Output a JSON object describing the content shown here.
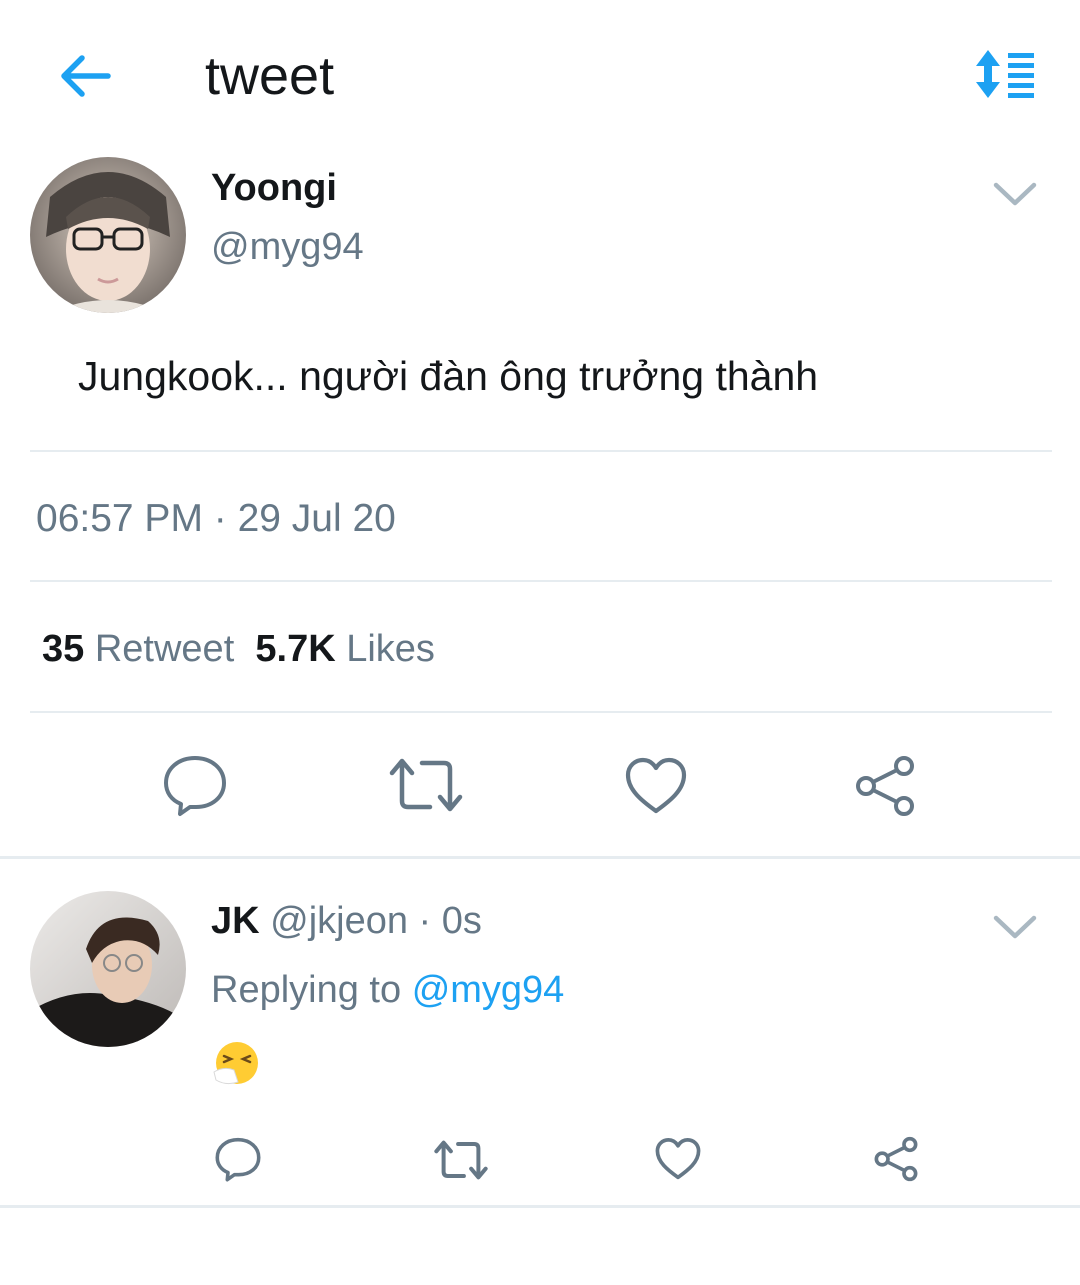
{
  "header": {
    "title": "tweet"
  },
  "tweet": {
    "author_name": "Yoongi",
    "author_handle": "@myg94",
    "text": "Jungkook... người đàn ông trưởng thành",
    "timestamp": "06:57 PM · 29 Jul 20",
    "retweet_count": "35",
    "retweet_label": "Retweet",
    "likes_count": "5.7K",
    "likes_label": "Likes"
  },
  "reply": {
    "author_name": "JK",
    "author_meta": "@jkjeon · 0s",
    "replying_label": "Replying to",
    "replying_handle": "@myg94"
  },
  "icons": {
    "back": "arrow-left-icon",
    "sort": "sort-list-icon",
    "more": "chevron-down-icon",
    "reply": "comment-icon",
    "retweet": "retweet-icon",
    "like": "heart-icon",
    "share": "share-icon",
    "emoji": "sneezing-face-emoji"
  },
  "colors": {
    "accent": "#1da1f2",
    "secondary_text": "#657786",
    "primary_text": "#14171a",
    "divider": "#e6ecf0"
  }
}
